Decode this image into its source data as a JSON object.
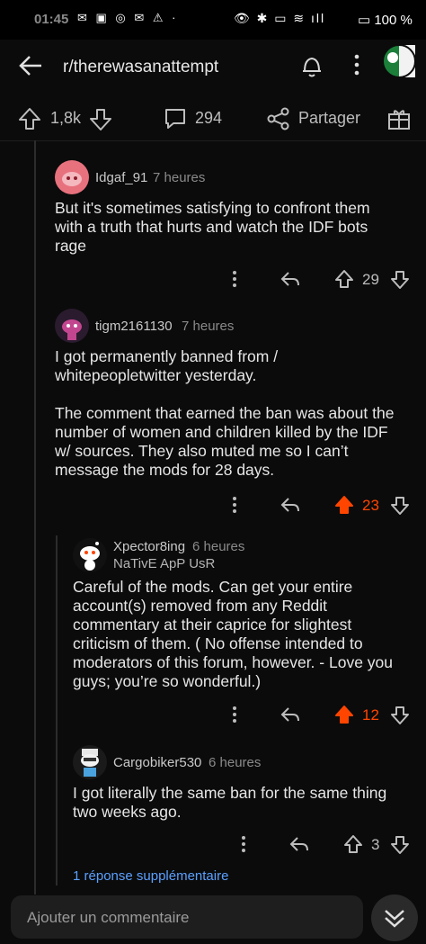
{
  "status_bar": {
    "time": "01:45",
    "battery": "100 %"
  },
  "header": {
    "title": "r/therewasanattempt"
  },
  "action_bar": {
    "votes": "1,8k",
    "comments": "294",
    "share_label": "Partager"
  },
  "comments": [
    {
      "user": "Idgaf_91",
      "time": "7 heures",
      "body": "But it's sometimes satisfying to confront them with a truth that hurts and watch the IDF bots rage",
      "score": "29"
    },
    {
      "user": "tigm2161130",
      "time": "7 heures",
      "body": "I got permanently banned from /\nwhitepeopletwitter yesterday.\n\nThe comment that earned the ban was about the number of women and children killed by the IDF w/ sources. They also muted me so I can’t message the mods for 28 days.",
      "score": "23"
    },
    {
      "user": "Xpector8ing",
      "time": "6 heures",
      "flair": "NaTivE ApP UsR",
      "body": "Careful of the mods. Can get your entire account(s) removed from any Reddit commentary at their caprice for slightest criticism of them. ( No offense intended to moderators of this forum, however. - Love you guys; you’re so wonderful.)",
      "score": "12"
    },
    {
      "user": "Cargobiker530",
      "time": "6 heures",
      "body": "I got literally the same ban for the same thing two weeks ago.",
      "score": "3"
    }
  ],
  "more_replies": "1 réponse supplémentaire",
  "comment_input": {
    "placeholder": "Ajouter un commentaire"
  },
  "colors": {
    "upvote_active": "#ff4500",
    "link": "#5aa0ff",
    "background": "#0b0b0b"
  }
}
